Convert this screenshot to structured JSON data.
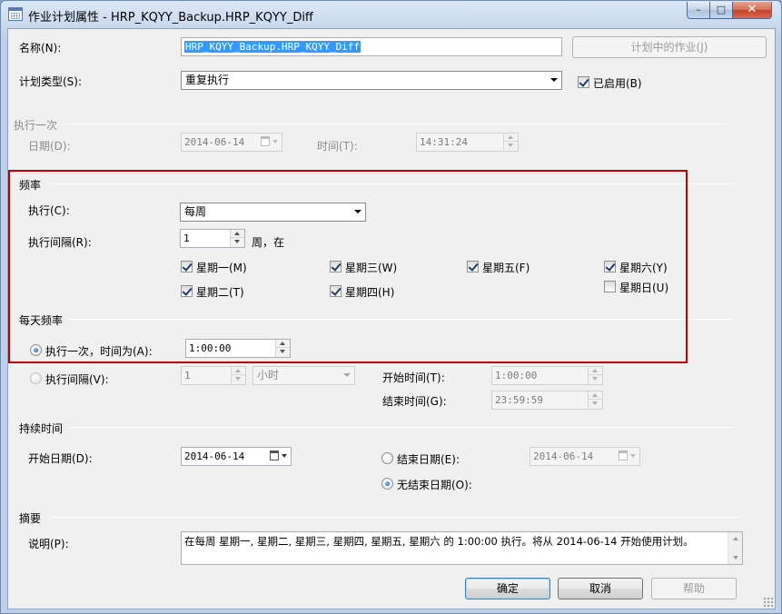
{
  "window": {
    "title": "作业计划属性 - HRP_KQYY_Backup.HRP_KQYY_Diff",
    "min_glyph": "–",
    "max_glyph": "□",
    "close_glyph": "✕"
  },
  "name": {
    "label": "名称(N):",
    "value": "HRP_KQYY_Backup.HRP_KQYY_Diff",
    "jobs_button": "计划中的作业(J)"
  },
  "schedule_type": {
    "label": "计划类型(S):",
    "value": "重复执行",
    "enabled_label": "已启用(B)",
    "enabled_checked": true
  },
  "one_time": {
    "group": "执行一次",
    "date_label": "日期(D):",
    "date_value": "2014-06-14",
    "time_label": "时间(T):",
    "time_value": "14:31:24"
  },
  "frequency": {
    "group": "频率",
    "occurs_label": "执行(C):",
    "occurs_value": "每周",
    "recur_label": "执行间隔(R):",
    "recur_value": "1",
    "recur_suffix": "周，在",
    "days": [
      {
        "label": "星期一(M)",
        "checked": true
      },
      {
        "label": "星期二(T)",
        "checked": true
      },
      {
        "label": "星期三(W)",
        "checked": true
      },
      {
        "label": "星期四(H)",
        "checked": true
      },
      {
        "label": "星期五(F)",
        "checked": true
      },
      {
        "label": "星期六(Y)",
        "checked": true
      },
      {
        "label": "星期日(U)",
        "checked": false
      }
    ]
  },
  "daily": {
    "group": "每天频率",
    "once_label": "执行一次，时间为(A):",
    "once_value": "1:00:00",
    "every_label": "执行间隔(V):",
    "every_value": "1",
    "every_unit": "小时",
    "start_label": "开始时间(T):",
    "start_value": "1:00:00",
    "end_label": "结束时间(G):",
    "end_value": "23:59:59"
  },
  "duration": {
    "group": "持续时间",
    "start_label": "开始日期(D):",
    "start_value": "2014-06-14",
    "end_date_label": "结束日期(E):",
    "end_date_value": "2014-06-14",
    "no_end_label": "无结束日期(O):"
  },
  "summary": {
    "group": "摘要",
    "desc_label": "说明(P):",
    "text": "在每周 星期一, 星期二, 星期三, 星期四, 星期五, 星期六 的 1:00:00 执行。将从 2014-06-14 开始使用计划。"
  },
  "buttons": {
    "ok": "确定",
    "cancel": "取消",
    "help": "帮助"
  },
  "colors": {
    "highlight_border": "#c00000",
    "selection": "#3399ff"
  }
}
